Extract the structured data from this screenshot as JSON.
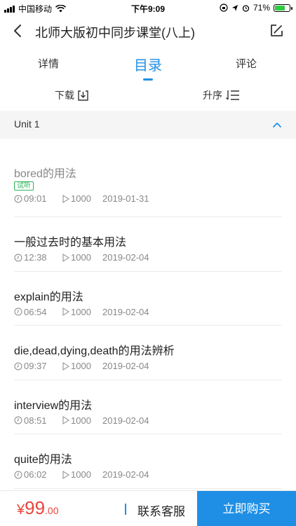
{
  "status_bar": {
    "carrier": "中国移动",
    "time": "下午9:09",
    "battery": "71%",
    "battery_level": 0.71
  },
  "nav": {
    "title": "北师大版初中同步课堂(八上)"
  },
  "tabs": [
    {
      "label": "详情",
      "active": false
    },
    {
      "label": "目录",
      "active": true
    },
    {
      "label": "评论",
      "active": false
    }
  ],
  "toolbar": {
    "download_label": "下载",
    "sort_label": "升序"
  },
  "unit": {
    "label": "Unit 1"
  },
  "lessons": [
    {
      "title": "bored的用法",
      "trial_label": "试听",
      "duration": "09:01",
      "plays": "1000",
      "date": "2019-01-31"
    },
    {
      "title": "一般过去时的基本用法",
      "duration": "12:38",
      "plays": "1000",
      "date": "2019-02-04"
    },
    {
      "title": "explain的用法",
      "duration": "06:54",
      "plays": "1000",
      "date": "2019-02-04"
    },
    {
      "title": "die,dead,dying,death的用法辨析",
      "duration": "09:37",
      "plays": "1000",
      "date": "2019-02-04"
    },
    {
      "title": "interview的用法",
      "duration": "08:51",
      "plays": "1000",
      "date": "2019-02-04"
    },
    {
      "title": "quite的用法",
      "duration": "06:02",
      "plays": "1000",
      "date": "2019-02-04"
    }
  ],
  "bottom_bar": {
    "price_currency": "¥",
    "price_integer": "99",
    "price_decimal": ".00",
    "contact_label": "联系客服",
    "buy_label": "立即购买"
  },
  "colors": {
    "accent": "#1f8fe6",
    "price": "#e8453c",
    "trial": "#2eb35a"
  }
}
